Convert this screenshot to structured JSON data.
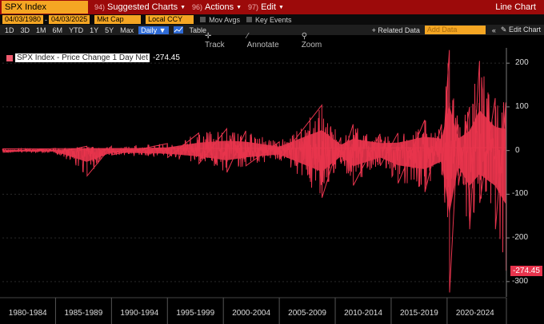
{
  "toolbar": {
    "ticker": "SPX Index",
    "menus": [
      {
        "num": "94)",
        "label": "Suggested Charts"
      },
      {
        "num": "96)",
        "label": "Actions"
      },
      {
        "num": "97)",
        "label": "Edit"
      }
    ],
    "window_title": "Line Chart"
  },
  "settings": {
    "start_date": "04/03/1980",
    "end_date": "04/03/2025",
    "mkt_cap": "Mkt Cap",
    "currency": "Local CCY",
    "mov_avgs": "Mov Avgs",
    "key_events": "Key Events"
  },
  "periods": {
    "items": [
      "1D",
      "3D",
      "1M",
      "6M",
      "YTD",
      "1Y",
      "5Y",
      "Max"
    ],
    "active": "Daily ▼",
    "table": "Table",
    "related_data": "+ Related Data",
    "add_data_placeholder": "Add Data",
    "edit_chart": "Edit Chart"
  },
  "tools": {
    "track": "Track",
    "annotate": "Annotate",
    "zoom": "Zoom"
  },
  "legend": {
    "label": "SPX Index - Price Change 1 Day Net",
    "value": "-274.45"
  },
  "chart_data": {
    "type": "area",
    "series": [
      {
        "name": "SPX Index - Price Change 1 Day Net",
        "color": "#e8344d"
      }
    ],
    "x_labels": [
      "1980-1984",
      "1985-1989",
      "1990-1994",
      "1995-1999",
      "2000-2004",
      "2005-2009",
      "2010-2014",
      "2015-2019",
      "2020-2024"
    ],
    "y_ticks": [
      200,
      100,
      0,
      -100,
      -200,
      -300
    ],
    "y_tick_labels": [
      "200",
      "100",
      "0",
      "-100",
      "-200",
      "-300"
    ],
    "ylim": [
      -335,
      235
    ],
    "last_value": -274.45,
    "last_value_label": "-274.45",
    "envelope": [
      {
        "year": 1980.3,
        "hi": 4,
        "lo": -4
      },
      {
        "year": 1985,
        "hi": 5,
        "lo": -5
      },
      {
        "year": 1987.8,
        "hi": 10,
        "lo": -58
      },
      {
        "year": 1990,
        "hi": 10,
        "lo": -10
      },
      {
        "year": 1995,
        "hi": 16,
        "lo": -16
      },
      {
        "year": 1997.8,
        "hi": 40,
        "lo": -30
      },
      {
        "year": 2000.3,
        "hi": 50,
        "lo": -50
      },
      {
        "year": 2002,
        "hi": 45,
        "lo": -35
      },
      {
        "year": 2005,
        "hi": 20,
        "lo": -20
      },
      {
        "year": 2008.8,
        "hi": 104,
        "lo": -108
      },
      {
        "year": 2010.5,
        "hi": 30,
        "lo": -30
      },
      {
        "year": 2011.6,
        "hi": 60,
        "lo": -80
      },
      {
        "year": 2014,
        "hi": 38,
        "lo": -35
      },
      {
        "year": 2015.6,
        "hi": 40,
        "lo": -75
      },
      {
        "year": 2018,
        "hi": 70,
        "lo": -95
      },
      {
        "year": 2019.5,
        "hi": 60,
        "lo": -55
      },
      {
        "year": 2020.2,
        "hi": 230,
        "lo": -325
      },
      {
        "year": 2021,
        "hi": 60,
        "lo": -80
      },
      {
        "year": 2022,
        "hi": 100,
        "lo": -180
      },
      {
        "year": 2022.9,
        "hi": 205,
        "lo": -120
      },
      {
        "year": 2024.3,
        "hi": 120,
        "lo": -180
      },
      {
        "year": 2025.25,
        "hi": 110,
        "lo": -274.45
      }
    ]
  }
}
